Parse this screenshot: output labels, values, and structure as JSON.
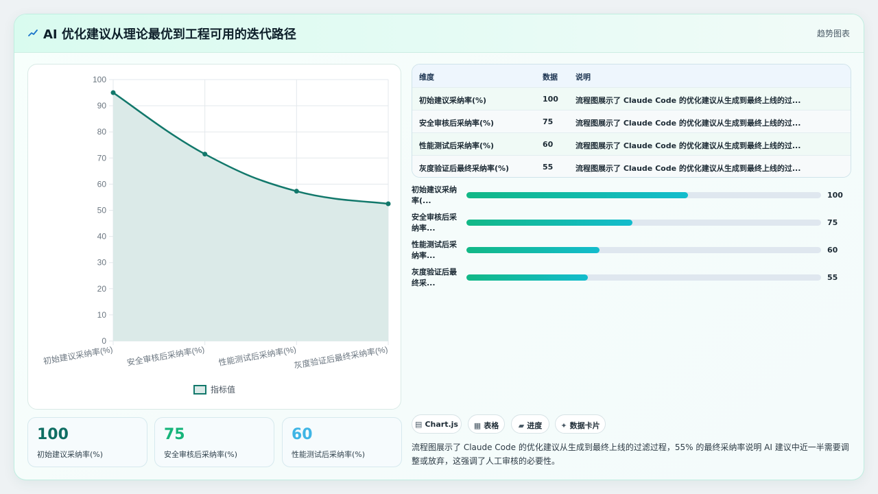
{
  "header": {
    "title": "AI 优化建议从理论最优到工程可用的迭代路径",
    "tag": "趋势图表"
  },
  "chart_data": {
    "type": "area",
    "categories": [
      "初始建议采纳率(%)",
      "安全审核后采纳率(%)",
      "性能测试后采纳率(%)",
      "灰度验证后最终采纳率(%)"
    ],
    "series": [
      {
        "name": "指标值",
        "values": [
          95,
          71.5,
          57.3,
          52.5
        ]
      }
    ],
    "ylim": [
      0,
      100
    ],
    "yticks": [
      0,
      10,
      20,
      30,
      40,
      50,
      60,
      70,
      80,
      90,
      100
    ],
    "grid": true,
    "legend": "bottom",
    "colors": {
      "line": "#12786b",
      "fill": "#dbeae8"
    }
  },
  "stats": [
    {
      "value": "100",
      "label": "初始建议采纳率(%)",
      "color": "#0f6e63"
    },
    {
      "value": "75",
      "label": "安全审核后采纳率(%)",
      "color": "#16b47a"
    },
    {
      "value": "60",
      "label": "性能测试后采纳率(%)",
      "color": "#3fb5e5"
    }
  ],
  "table": {
    "headers": [
      "维度",
      "数据",
      "说明"
    ],
    "rows": [
      {
        "dim": "初始建议采纳率(%)",
        "val": "100",
        "note": "流程图展示了 Claude Code 的优化建议从生成到最终上线的过..."
      },
      {
        "dim": "安全审核后采纳率(%)",
        "val": "75",
        "note": "流程图展示了 Claude Code 的优化建议从生成到最终上线的过..."
      },
      {
        "dim": "性能测试后采纳率(%)",
        "val": "60",
        "note": "流程图展示了 Claude Code 的优化建议从生成到最终上线的过..."
      },
      {
        "dim": "灰度验证后最终采纳率(%)",
        "val": "55",
        "note": "流程图展示了 Claude Code 的优化建议从生成到最终上线的过..."
      }
    ]
  },
  "progress": [
    {
      "label": "初始建议采纳率(...",
      "value": "100",
      "fraction": 0.625
    },
    {
      "label": "安全审核后采纳率...",
      "value": "75",
      "fraction": 0.468
    },
    {
      "label": "性能测试后采纳率...",
      "value": "60",
      "fraction": 0.375
    },
    {
      "label": "灰度验证后最终采...",
      "value": "55",
      "fraction": 0.343
    }
  ],
  "chips": [
    {
      "icon": "▤",
      "label": "Chart.js"
    },
    {
      "icon": "▦",
      "label": "表格"
    },
    {
      "icon": "▰",
      "label": "进度"
    },
    {
      "icon": "✦",
      "label": "数据卡片"
    }
  ],
  "description": "流程图展示了 Claude Code 的优化建议从生成到最终上线的过滤过程，55% 的最终采纳率说明 AI 建议中近一半需要调整或放弃，这强调了人工审核的必要性。"
}
